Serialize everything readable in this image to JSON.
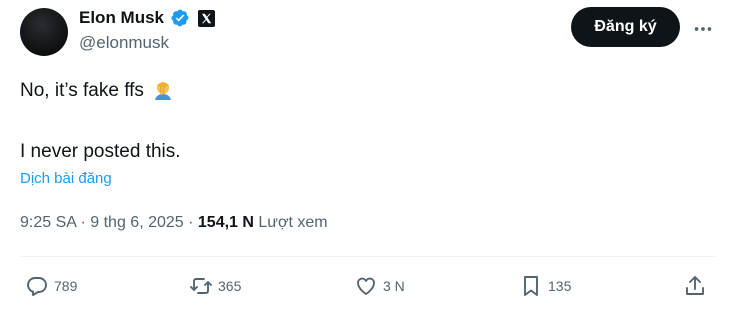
{
  "author": {
    "name": "Elon Musk",
    "handle": "@elonmusk",
    "verified_icon": "verified-badge-icon",
    "affiliation_icon": "x-logo-icon"
  },
  "header": {
    "subscribe_label": "Đăng ký",
    "more_icon": "more-dots-icon"
  },
  "post": {
    "line1": "No, it’s fake ffs",
    "line1_emoji": "person-facepalming-emoji",
    "line2": "I never posted this.",
    "translate_label": "Dịch bài đăng"
  },
  "meta": {
    "time": "9:25 SA",
    "sep1": " · ",
    "date": "9 thg 6, 2025",
    "sep2": " · ",
    "views_count": "154,1 N",
    "views_label": " Lượt xem"
  },
  "actions": {
    "reply_count": "789",
    "repost_count": "365",
    "like_count": "3 N",
    "bookmark_count": "135"
  },
  "colors": {
    "text": "#0f1419",
    "secondary": "#536471",
    "link": "#1d9bf0",
    "verified": "#1d9bf0"
  }
}
